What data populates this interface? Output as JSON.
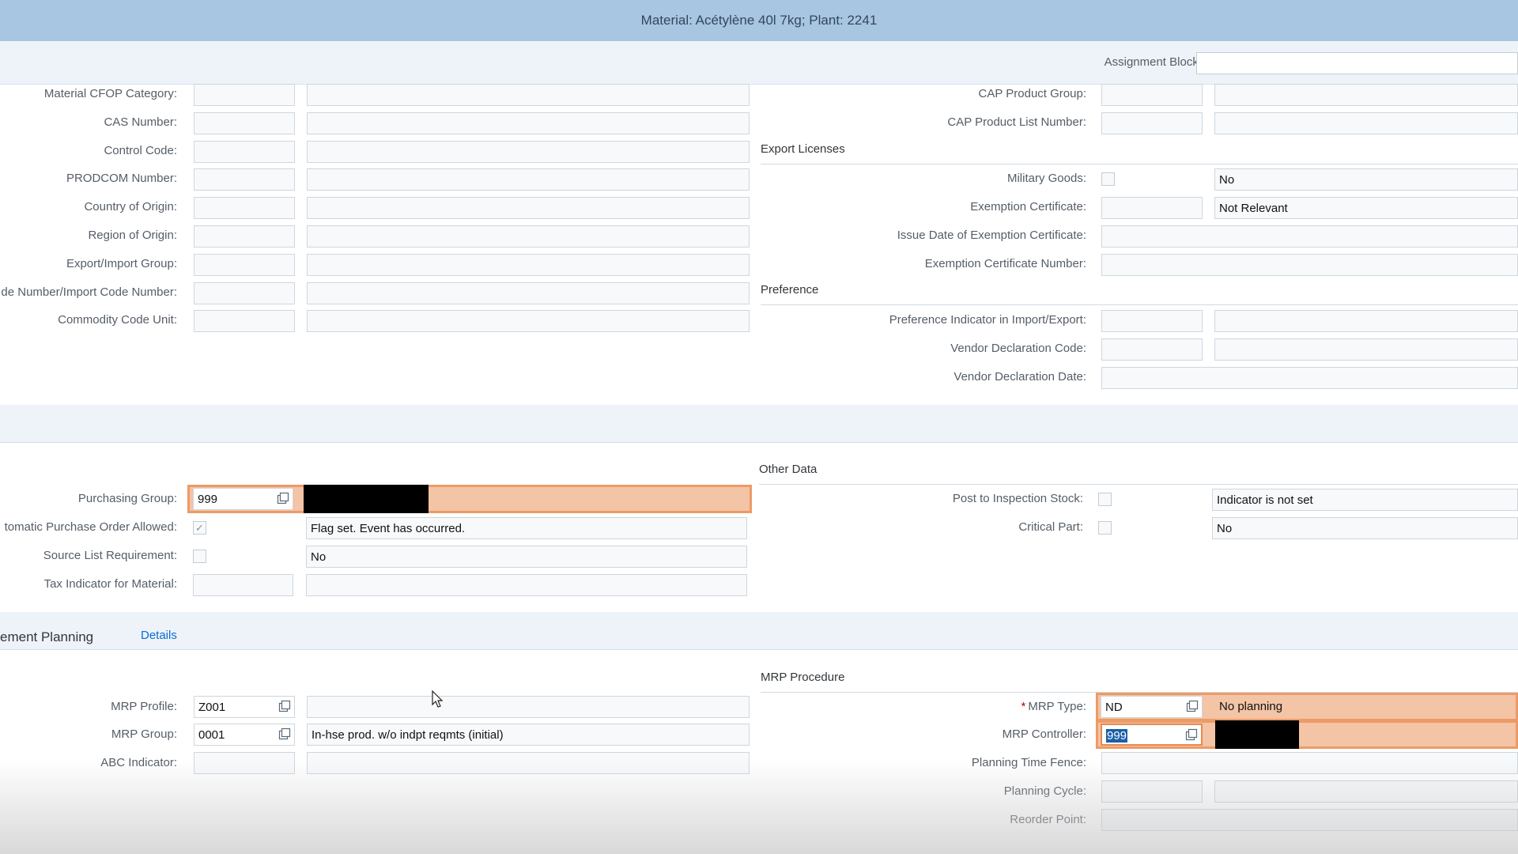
{
  "title": "Material: Acétylène 40l 7kg; Plant: 2241",
  "assignment_block": {
    "label": "Assignment Block:",
    "value": ""
  },
  "foreign_trade_left": [
    {
      "label": "Material CFOP Category:",
      "code": "",
      "desc": ""
    },
    {
      "label": "CAS Number:",
      "code": "",
      "desc": ""
    },
    {
      "label": "Control Code:",
      "code": "",
      "desc": ""
    },
    {
      "label": "PRODCOM Number:",
      "code": "",
      "desc": ""
    },
    {
      "label": "Country of Origin:",
      "code": "",
      "desc": ""
    },
    {
      "label": "Region of Origin:",
      "code": "",
      "desc": ""
    },
    {
      "label": "Export/Import Group:",
      "code": "",
      "desc": ""
    },
    {
      "label": "de Number/Import Code Number:",
      "code": "",
      "desc": ""
    },
    {
      "label": "Commodity Code Unit:",
      "code": "",
      "desc": ""
    }
  ],
  "foreign_trade_right": {
    "cap_product_group": {
      "label": "CAP Product Group:",
      "code": "",
      "desc": ""
    },
    "cap_product_list_number": {
      "label": "CAP Product List Number:",
      "code": "",
      "desc": ""
    },
    "export_licenses": {
      "title": "Export Licenses",
      "military_goods": {
        "label": "Military Goods:",
        "checked": false,
        "desc": "No"
      },
      "exemption_certificate": {
        "label": "Exemption Certificate:",
        "code": "",
        "desc": "Not Relevant"
      },
      "issue_date": {
        "label": "Issue Date of Exemption Certificate:",
        "value": ""
      },
      "certificate_number": {
        "label": "Exemption Certificate Number:",
        "value": ""
      }
    },
    "preference": {
      "title": "Preference",
      "indicator": {
        "label": "Preference Indicator in Import/Export:",
        "code": "",
        "desc": ""
      },
      "vendor_code": {
        "label": "Vendor Declaration Code:",
        "code": "",
        "desc": ""
      },
      "vendor_date": {
        "label": "Vendor Declaration Date:",
        "value": ""
      }
    }
  },
  "purchasing": {
    "purchasing_group": {
      "label": "Purchasing Group:",
      "value": "999",
      "desc": ""
    },
    "auto_po": {
      "label": "tomatic Purchase Order Allowed:",
      "checked": true,
      "desc": "Flag set. Event has occurred."
    },
    "source_list": {
      "label": "Source List Requirement:",
      "checked": false,
      "desc": "No"
    },
    "tax_indicator": {
      "label": "Tax Indicator for Material:",
      "code": "",
      "desc": ""
    }
  },
  "other_data": {
    "title": "Other Data",
    "post_to_inspection": {
      "label": "Post to Inspection Stock:",
      "checked": false,
      "desc": "Indicator is not set"
    },
    "critical_part": {
      "label": "Critical Part:",
      "checked": false,
      "desc": "No"
    }
  },
  "tabs": {
    "active": "ement Planning",
    "details": "Details"
  },
  "mrp_left": {
    "mrp_profile": {
      "label": "MRP Profile:",
      "value": "Z001",
      "desc": ""
    },
    "mrp_group": {
      "label": "MRP Group:",
      "value": "0001",
      "desc": "In-hse prod. w/o indpt reqmts (initial)"
    },
    "abc_indicator": {
      "label": "ABC Indicator:",
      "code": "",
      "desc": ""
    }
  },
  "mrp_procedure": {
    "title": "MRP Procedure",
    "required_marker": "*",
    "mrp_type": {
      "label": "MRP Type:",
      "value": "ND",
      "desc": "No planning"
    },
    "mrp_controller": {
      "label": "MRP Controller:",
      "value": "999"
    },
    "planning_time_fence": {
      "label": "Planning Time Fence:",
      "value": ""
    },
    "planning_cycle": {
      "label": "Planning Cycle:",
      "code": "",
      "desc": ""
    },
    "reorder_point": {
      "label": "Reorder Point:",
      "value": ""
    }
  },
  "colors": {
    "header": "#a8c5e2",
    "highlight": "#f3c4a6",
    "highlight_border": "#ee9a66",
    "link": "#0a6ed1"
  }
}
